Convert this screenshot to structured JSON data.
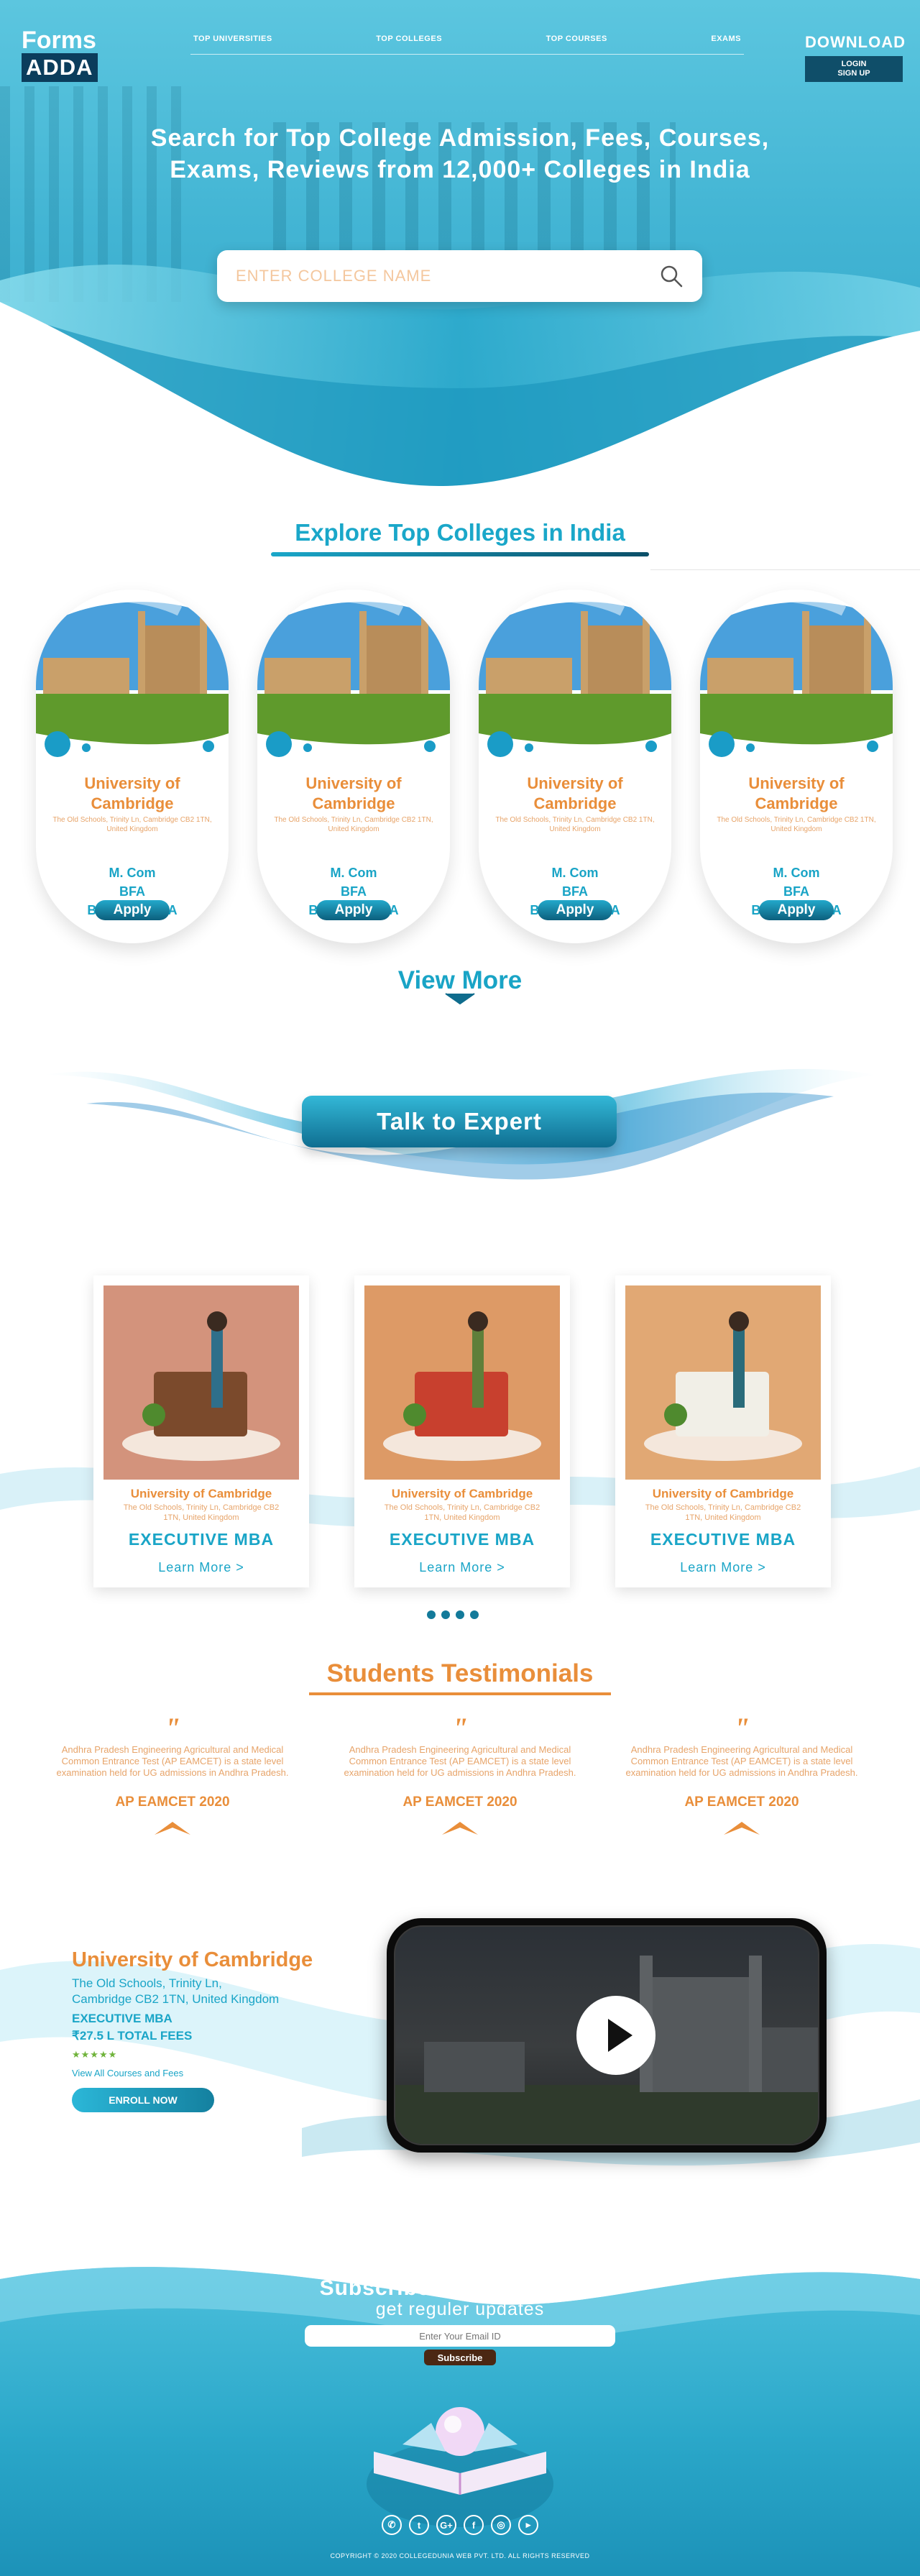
{
  "logo": {
    "line1": "Forms",
    "line2": "ADDA"
  },
  "nav": {
    "items": [
      "TOP UNIVERSITIES",
      "TOP COLLEGES",
      "TOP COURSES",
      "EXAMS"
    ]
  },
  "header": {
    "download": "DOWNLOAD",
    "login": "LOGIN",
    "signup": "SIGN UP"
  },
  "hero": {
    "title_line1": "Search for Top College Admission, Fees, Courses,",
    "title_line2": "Exams, Reviews from 12,000+ Colleges in India",
    "search_placeholder": "ENTER COLLEGE NAME",
    "search_icon": "search-icon"
  },
  "explore": {
    "title": "Explore Top Colleges in India",
    "cards": [
      {
        "name": "University of Cambridge",
        "address": "The Old Schools, Trinity Ln, Cambridge CB2 1TN, United Kingdom",
        "courses": [
          "M. Com",
          "BFA",
          "B. Tech + MBA"
        ],
        "apply": "Apply"
      },
      {
        "name": "University of Cambridge",
        "address": "The Old Schools, Trinity Ln, Cambridge CB2 1TN, United Kingdom",
        "courses": [
          "M. Com",
          "BFA",
          "B. Tech + MBA"
        ],
        "apply": "Apply"
      },
      {
        "name": "University of Cambridge",
        "address": "The Old Schools, Trinity Ln, Cambridge CB2 1TN, United Kingdom",
        "courses": [
          "M. Com",
          "BFA",
          "B. Tech + MBA"
        ],
        "apply": "Apply"
      },
      {
        "name": "University of Cambridge",
        "address": "The Old Schools, Trinity Ln, Cambridge CB2 1TN, United Kingdom",
        "courses": [
          "M. Com",
          "BFA",
          "B. Tech + MBA"
        ],
        "apply": "Apply"
      }
    ],
    "view_more": "View More"
  },
  "expert": {
    "label": "Talk to Expert"
  },
  "programs": {
    "cards": [
      {
        "name": "University of Cambridge",
        "address": "The Old Schools, Trinity Ln, Cambridge CB2 1TN, United Kingdom",
        "program": "EXECUTIVE MBA",
        "link": "Learn More >"
      },
      {
        "name": "University of Cambridge",
        "address": "The Old Schools, Trinity Ln, Cambridge CB2 1TN, United Kingdom",
        "program": "EXECUTIVE MBA",
        "link": "Learn More >"
      },
      {
        "name": "University of Cambridge",
        "address": "The Old Schools, Trinity Ln, Cambridge CB2 1TN, United Kingdom",
        "program": "EXECUTIVE MBA",
        "link": "Learn More >"
      }
    ],
    "pagination_dots": 4
  },
  "testimonials": {
    "title": "Students Testimonials",
    "items": [
      {
        "text": "Andhra Pradesh Engineering Agricultural and Medical Common Entrance Test (AP EAMCET) is a state level examination held for UG admissions in Andhra Pradesh.",
        "name": "AP EAMCET 2020"
      },
      {
        "text": "Andhra Pradesh Engineering Agricultural and Medical Common Entrance Test (AP EAMCET) is a state level examination held for UG admissions in Andhra Pradesh.",
        "name": "AP EAMCET 2020"
      },
      {
        "text": "Andhra Pradesh Engineering Agricultural and Medical Common Entrance Test (AP EAMCET) is a state level examination held for UG admissions in Andhra Pradesh.",
        "name": "AP EAMCET 2020"
      }
    ]
  },
  "featured": {
    "name": "University of Cambridge",
    "address_line1": "The Old Schools, Trinity Ln,",
    "address_line2": "Cambridge CB2 1TN, United Kingdom",
    "program": "EXECUTIVE MBA",
    "fees": "₹27.5 L TOTAL FEES",
    "stars": "★★★★★",
    "rating": 5,
    "link": "View All Courses and Fees",
    "enroll": "ENROLL NOW",
    "video_icon": "play-icon"
  },
  "newsletter": {
    "title": "Subscribe Our Newsletter",
    "subtitle": "get reguler updates",
    "input_placeholder": "Enter Your Email ID",
    "button": "Subscribe"
  },
  "social": [
    "whatsapp-icon",
    "twitter-icon",
    "google-plus-icon",
    "facebook-icon",
    "instagram-icon",
    "youtube-icon"
  ],
  "footer": {
    "copyright": "COPYRIGHT © 2020 COLLEGEDUNIA WEB PVT. LTD. ALL RIGHTS RESERVED"
  },
  "colors": {
    "primary": "#1aa7c9",
    "accent": "#e98e3a",
    "dark": "#0b3d5c"
  }
}
